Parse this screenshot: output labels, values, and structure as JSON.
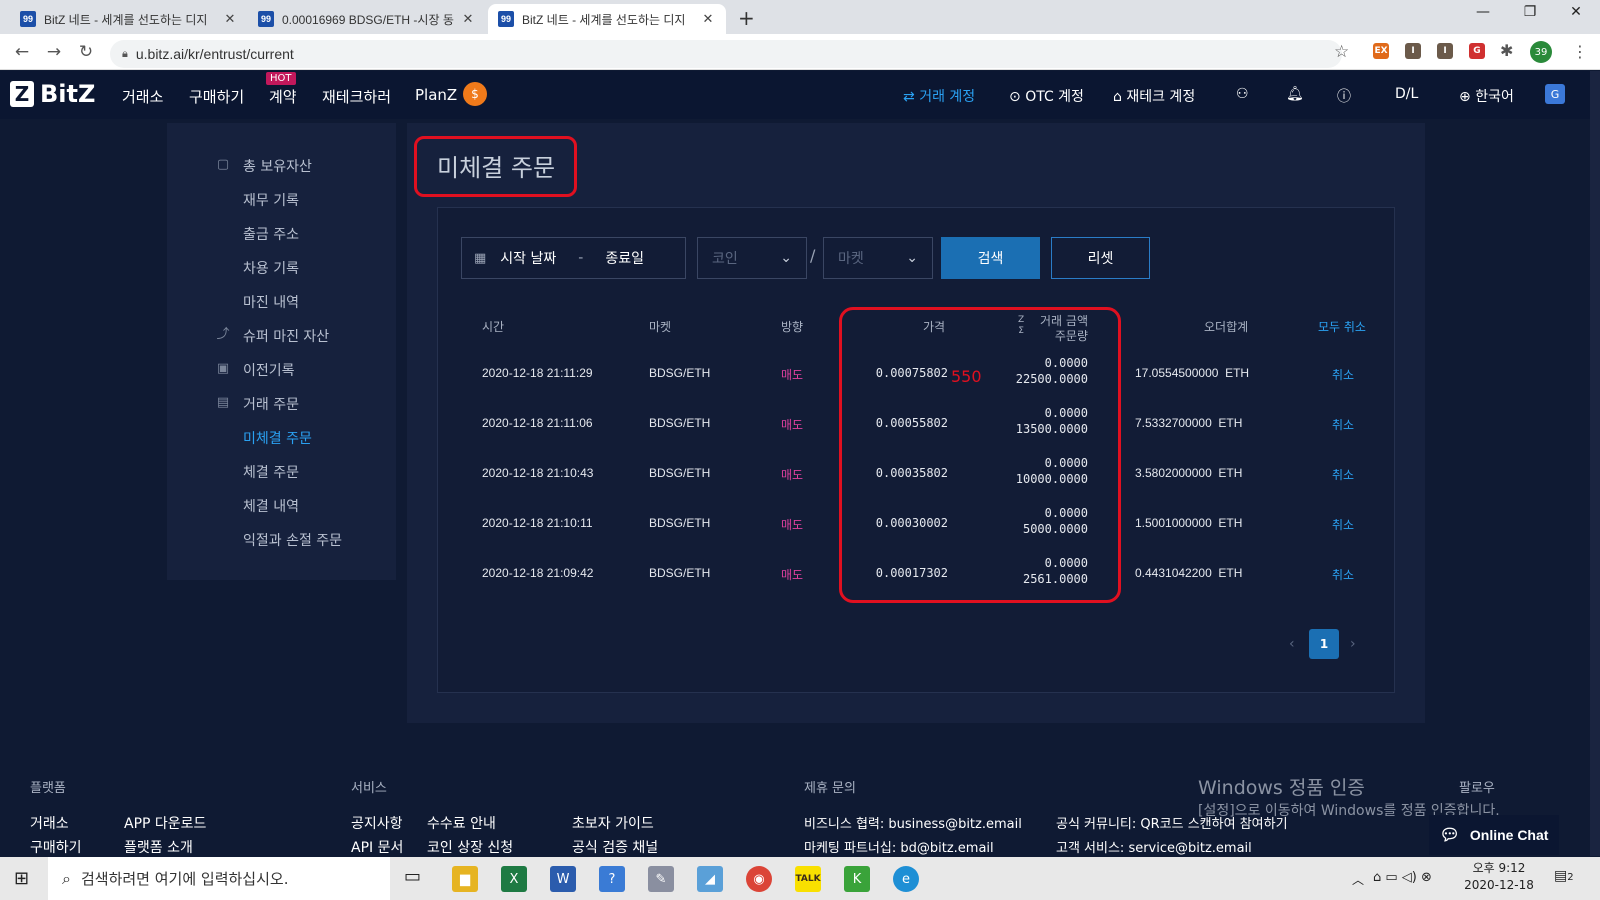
{
  "browser": {
    "tabs": [
      {
        "favicon": "99",
        "title": "BitZ 네트 - 세계를 선도하는 디지"
      },
      {
        "favicon": "99",
        "title": "0.00016969 BDSG/ETH -시장 동"
      },
      {
        "favicon": "99",
        "title": "BitZ 네트 - 세계를 선도하는 디지"
      }
    ],
    "url": "u.bitz.ai/kr/entrust/current",
    "profile_badge": "39"
  },
  "header": {
    "logo": "BitZ",
    "logo_mark": "Z",
    "menu": [
      "거래소",
      "구매하기",
      "계약",
      "재테크하러",
      "PlanZ"
    ],
    "hot_badge": "HOT",
    "right": {
      "trade_account": "거래 계정",
      "otc_account": "OTC 계정",
      "finance_account": "재테크 계정",
      "dl": "D/L",
      "language": "한국어"
    }
  },
  "sidebar": {
    "items": [
      {
        "label": "총 보유자산",
        "icon": "wallet-icon"
      },
      {
        "label": "재무 기록"
      },
      {
        "label": "출금 주소"
      },
      {
        "label": "차용 기록"
      },
      {
        "label": "마진 내역"
      },
      {
        "label": "슈퍼 마진 자산",
        "icon": "chart-icon"
      },
      {
        "label": "이전기록",
        "icon": "history-icon"
      },
      {
        "label": "거래 주문",
        "icon": "clipboard-icon"
      },
      {
        "label": "미체결 주문",
        "active": true
      },
      {
        "label": "체결 주문"
      },
      {
        "label": "체결 내역"
      },
      {
        "label": "익절과 손절 주문"
      }
    ]
  },
  "main": {
    "title": "미체결 주문",
    "filters": {
      "start_date": "시작 날짜",
      "date_sep": "-",
      "end_date": "종료일",
      "coin": "코인",
      "slash": "/",
      "market": "마켓",
      "search": "검색",
      "reset": "리셋"
    },
    "table": {
      "headers": {
        "time": "시간",
        "market": "마켓",
        "direction": "방향",
        "price": "가격",
        "amount_top": "거래 금액",
        "amount_bottom": "주문량",
        "total": "오더합계",
        "cancel_all": "모두 취소"
      },
      "rows": [
        {
          "time": "2020-12-18 21:11:29",
          "market": "BDSG/ETH",
          "side": "매도",
          "price": "0.00075802",
          "filled": "0.0000",
          "qty": "22500.0000",
          "total": "17.0554500000",
          "unit": "ETH",
          "cancel": "취소"
        },
        {
          "time": "2020-12-18 21:11:06",
          "market": "BDSG/ETH",
          "side": "매도",
          "price": "0.00055802",
          "filled": "0.0000",
          "qty": "13500.0000",
          "total": "7.5332700000",
          "unit": "ETH",
          "cancel": "취소"
        },
        {
          "time": "2020-12-18 21:10:43",
          "market": "BDSG/ETH",
          "side": "매도",
          "price": "0.00035802",
          "filled": "0.0000",
          "qty": "10000.0000",
          "total": "3.5802000000",
          "unit": "ETH",
          "cancel": "취소"
        },
        {
          "time": "2020-12-18 21:10:11",
          "market": "BDSG/ETH",
          "side": "매도",
          "price": "0.00030002",
          "filled": "0.0000",
          "qty": "5000.0000",
          "total": "1.5001000000",
          "unit": "ETH",
          "cancel": "취소"
        },
        {
          "time": "2020-12-18 21:09:42",
          "market": "BDSG/ETH",
          "side": "매도",
          "price": "0.00017302",
          "filled": "0.0000",
          "qty": "2561.0000",
          "total": "0.4431042200",
          "unit": "ETH",
          "cancel": "취소"
        }
      ]
    },
    "annotation": "550",
    "pagination": {
      "current": "1"
    }
  },
  "footer": {
    "platform": {
      "heading": "플랫폼",
      "links": [
        "거래소",
        "APP 다운로드",
        "구매하기",
        "플랫폼 소개"
      ]
    },
    "service": {
      "heading": "서비스",
      "links": [
        "공지사항",
        "수수료 안내",
        "초보자 가이드",
        "API 문서",
        "코인 상장 신청",
        "공식 검증 채널"
      ]
    },
    "contact": {
      "heading": "제휴 문의",
      "business": "비즈니스 협력: business@bitz.email",
      "community": "공식 커뮤니티: QR코드 스캔하여 참여하기",
      "marketing": "마케팅 파트너십: bd@bitz.email",
      "support": "고객 서비스: service@bitz.email"
    },
    "follow": "팔로우",
    "chat": "Online Chat"
  },
  "watermark": {
    "line1": "Windows 정품 인증",
    "line2": "[설정]으로 이동하여 Windows를 정품 인증합니다."
  },
  "taskbar": {
    "search": "검색하려면 여기에 입력하십시오.",
    "time": "오후 9:12",
    "date": "2020-12-18",
    "notif": "2"
  }
}
